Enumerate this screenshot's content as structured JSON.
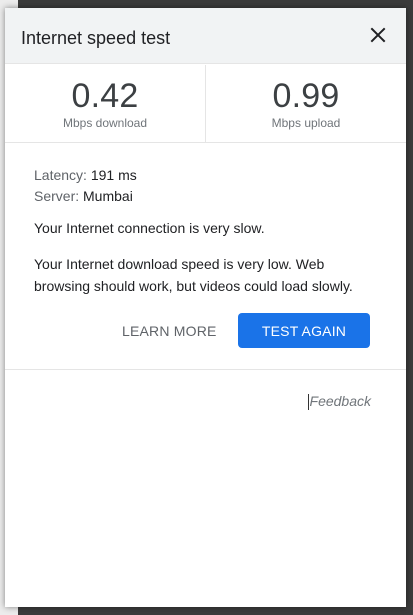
{
  "dialog": {
    "title": "Internet speed test",
    "close_icon": "close-icon"
  },
  "metrics": {
    "download": {
      "value": "0.42",
      "label": "Mbps download"
    },
    "upload": {
      "value": "0.99",
      "label": "Mbps upload"
    }
  },
  "details": {
    "latency_label": "Latency:",
    "latency_value": "191 ms",
    "server_label": "Server:",
    "server_value": "Mumbai"
  },
  "messages": {
    "summary": "Your Internet connection is very slow.",
    "description": "Your Internet download speed is very low. Web browsing should work, but videos could load slowly."
  },
  "actions": {
    "learn_more_label": "LEARN MORE",
    "test_again_label": "TEST AGAIN"
  },
  "footer": {
    "feedback_label": "Feedback"
  },
  "colors": {
    "primary": "#1a73e8",
    "text": "#202124",
    "secondary_text": "#5f6368"
  }
}
